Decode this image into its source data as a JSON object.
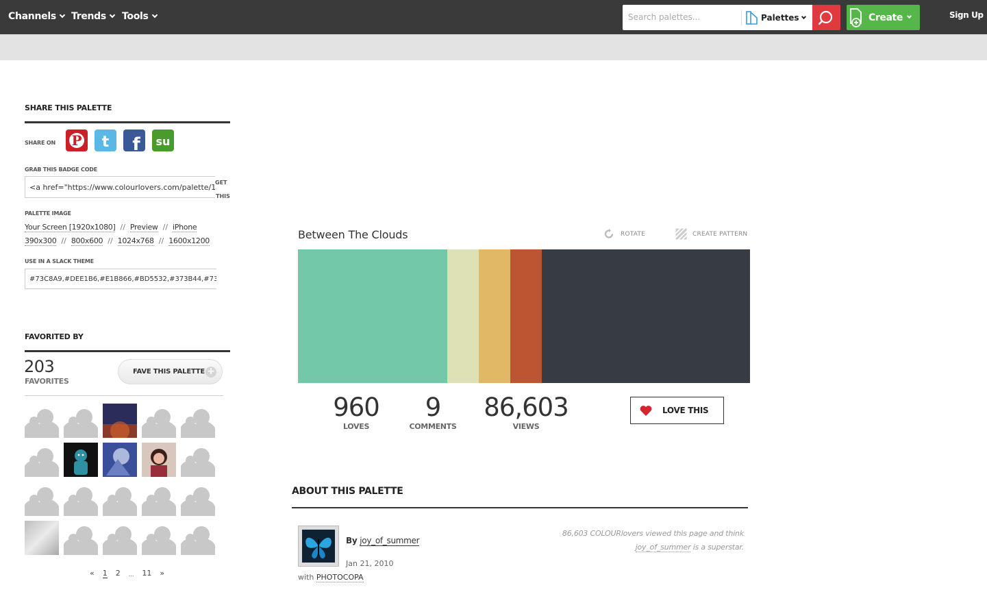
{
  "nav": {
    "channels": "Channels",
    "trends": "Trends",
    "tools": "Tools",
    "search_placeholder": "Search palettes...",
    "palettes_select": "Palettes",
    "create": "Create",
    "signup": "Sign Up"
  },
  "sidebar": {
    "share_heading": "SHARE THIS PALETTE",
    "share_on": "SHARE ON",
    "badge_label": "GRAB THIS BADGE CODE",
    "badge_code": "<a href=\"https://www.colourlovers.com/palette/1",
    "get_this_1": "GET",
    "get_this_2": "THIS",
    "image_label": "PALETTE IMAGE",
    "image_links": {
      "your_screen": "Your Screen [1920x1080]",
      "preview": "Preview",
      "iphone": "iPhone",
      "s390": "390x300",
      "s800": "800x600",
      "s1024": "1024x768",
      "s1600": "1600x1200",
      "sep": "//"
    },
    "slack_label": "USE IN A SLACK THEME",
    "slack_value": "#73C8A9,#DEE1B6,#E1B866,#BD5532,#373B44,#73",
    "favorited_heading": "FAVORITED BY",
    "fav_count": "203",
    "fav_label": "FAVORITES",
    "fave_button": "FAVE THIS PALETTE",
    "pager": {
      "prev": "«",
      "p1": "1",
      "p2": "2",
      "ellipsis": "...",
      "p11": "11",
      "next": "»"
    }
  },
  "palette": {
    "title": "Between The Clouds",
    "rotate": "ROTATE",
    "create_pattern": "CREATE PATTERN",
    "colors": [
      "#73C8A9",
      "#DEE1B6",
      "#E1B866",
      "#BD5532",
      "#373B44"
    ],
    "widths": [
      0.33,
      0.07,
      0.07,
      0.07,
      0.46
    ]
  },
  "stats": {
    "loves": "960",
    "loves_label": "LOVES",
    "comments": "9",
    "comments_label": "COMMENTS",
    "views": "86,603",
    "views_label": "VIEWS",
    "love_button": "LOVE THIS"
  },
  "about": {
    "heading": "ABOUT THIS PALETTE",
    "by_prefix": "By ",
    "author": "joy_of_summer",
    "date": "Jan 21, 2010",
    "with_prefix": "with ",
    "with_tool": "PHOTOCOPA",
    "quote_line1": "86,603 COLOURlovers viewed this page and think",
    "quote_author": "joy_of_summer",
    "quote_line2": " is a superstar."
  }
}
